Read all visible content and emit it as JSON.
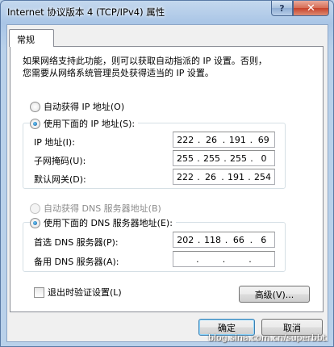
{
  "window": {
    "title": "Internet 协议版本 4 (TCP/IPv4) 属性",
    "help_label": "?",
    "close_label": "✕"
  },
  "tabs": [
    {
      "label": "常规",
      "selected": true
    }
  ],
  "intro": {
    "line1": "如果网络支持此功能，则可以获取自动指派的 IP 设置。否则，",
    "line2": "您需要从网络系统管理员处获得适当的 IP 设置。"
  },
  "ip_section": {
    "auto_label": "自动获得 IP 地址(O)",
    "manual_label": "使用下面的 IP 地址(S):",
    "selected": "manual",
    "fields": [
      {
        "label": "IP 地址(I):",
        "octets": [
          "222",
          "26",
          "191",
          "69"
        ]
      },
      {
        "label": "子网掩码(U):",
        "octets": [
          "255",
          "255",
          "255",
          "0"
        ]
      },
      {
        "label": "默认网关(D):",
        "octets": [
          "222",
          "26",
          "191",
          "254"
        ]
      }
    ]
  },
  "dns_section": {
    "auto_label": "自动获得 DNS 服务器地址(B)",
    "manual_label": "使用下面的 DNS 服务器地址(E):",
    "selected": "manual",
    "fields": [
      {
        "label": "首选 DNS 服务器(P):",
        "octets": [
          "202",
          "118",
          "66",
          "6"
        ]
      },
      {
        "label": "备用 DNS 服务器(A):",
        "octets": [
          "",
          "",
          "",
          ""
        ]
      }
    ]
  },
  "validate_on_exit": {
    "label": "退出时验证设置(L)",
    "checked": false
  },
  "buttons": {
    "advanced": "高级(V)...",
    "ok": "确定",
    "cancel": "取消"
  },
  "watermark": "blog.sina.com.cn/superbbt"
}
